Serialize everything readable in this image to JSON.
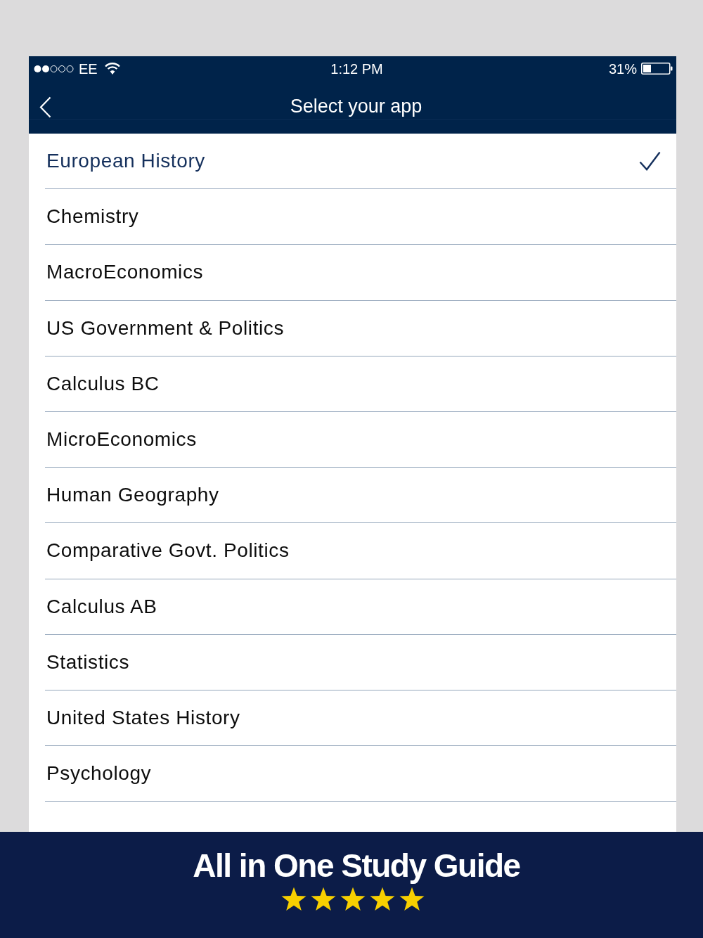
{
  "status_bar": {
    "carrier": "EE",
    "time": "1:12 PM",
    "battery": "31%"
  },
  "nav_bar": {
    "title": "Select your app"
  },
  "apps": [
    {
      "label": "European History",
      "selected": true
    },
    {
      "label": "Chemistry",
      "selected": false
    },
    {
      "label": "MacroEconomics",
      "selected": false
    },
    {
      "label": "US Government & Politics",
      "selected": false
    },
    {
      "label": "Calculus BC",
      "selected": false
    },
    {
      "label": "MicroEconomics",
      "selected": false
    },
    {
      "label": "Human Geography",
      "selected": false
    },
    {
      "label": "Comparative Govt. Politics",
      "selected": false
    },
    {
      "label": "Calculus AB",
      "selected": false
    },
    {
      "label": "Statistics",
      "selected": false
    },
    {
      "label": "United States History",
      "selected": false
    },
    {
      "label": "Psychology",
      "selected": false
    }
  ],
  "banner": {
    "title": "All in One Study Guide",
    "stars": 5
  }
}
